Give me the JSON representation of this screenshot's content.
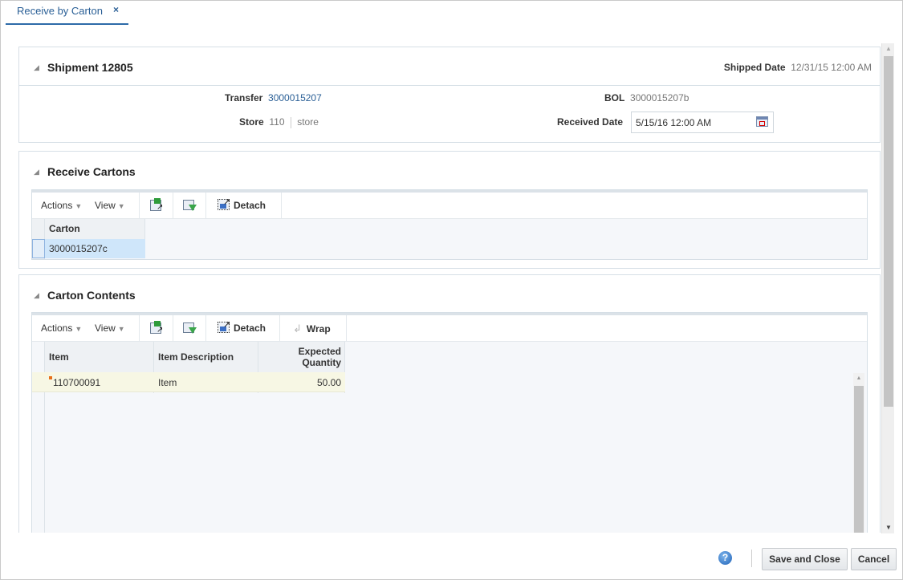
{
  "tab": {
    "label": "Receive by Carton",
    "close_icon": "×"
  },
  "shipment": {
    "title": "Shipment 12805",
    "shipped_date_label": "Shipped Date",
    "shipped_date_value": "12/31/15 12:00 AM",
    "transfer_label": "Transfer",
    "transfer_value": "3000015207",
    "store_label": "Store",
    "store_id": "110",
    "store_name": "store",
    "bol_label": "BOL",
    "bol_value": "3000015207b",
    "received_date_label": "Received Date",
    "received_date_value": "5/15/16 12:00 AM"
  },
  "receive_cartons": {
    "title": "Receive Cartons",
    "toolbar": {
      "actions": "Actions",
      "view": "View",
      "detach": "Detach"
    },
    "columns": [
      "Carton"
    ],
    "rows": [
      {
        "carton": "3000015207c"
      }
    ]
  },
  "carton_contents": {
    "title": "Carton Contents",
    "toolbar": {
      "actions": "Actions",
      "view": "View",
      "detach": "Detach",
      "wrap": "Wrap"
    },
    "columns": {
      "item": "Item",
      "description": "Item Description",
      "expected_qty_line1": "Expected",
      "expected_qty_line2": "Quantity"
    },
    "rows": [
      {
        "item": "110700091",
        "description": "Item",
        "expected_qty": "50.00"
      }
    ]
  },
  "footer": {
    "help": "?",
    "save_close": "Save and Close",
    "cancel": "Cancel"
  }
}
